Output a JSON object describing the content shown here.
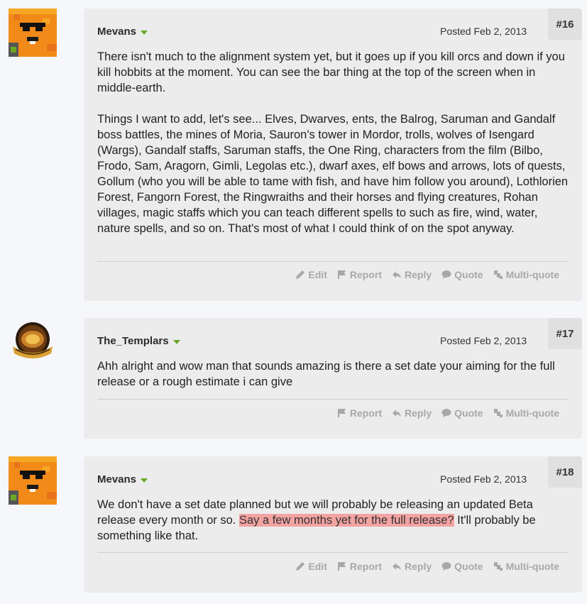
{
  "posts": [
    {
      "number": "#16",
      "author": "Mevans",
      "posted": "Posted Feb 2, 2013",
      "paragraphs": [
        "There isn't much to the alignment system yet, but it goes up if you kill orcs and down if you kill hobbits at the moment. You can see the bar thing at the top of the screen when in middle-earth.",
        "Things I want to add, let's see... Elves, Dwarves, ents, the Balrog, Saruman and Gandalf boss battles, the mines of Moria, Sauron's tower in Mordor, trolls, wolves of Isengard (Wargs), Gandalf staffs, Saruman staffs, the One Ring, characters from the film (Bilbo, Frodo, Sam, Aragorn, Gimli, Legolas etc.), dwarf axes, elf bows and arrows, lots of quests, Gollum (who you will be able to tame with fish, and have him follow you around), Lothlorien Forest, Fangorn Forest, the Ringwraiths and their horses and flying creatures, Rohan villages, magic staffs which you can teach different spells to such as fire, wind, water, nature spells, and so on. That's most of what I could think of on the spot anyway."
      ],
      "actions": {
        "edit": "Edit",
        "report": "Report",
        "reply": "Reply",
        "quote": "Quote",
        "multiquote": "Multi-quote"
      }
    },
    {
      "number": "#17",
      "author": "The_Templars",
      "posted": "Posted Feb 2, 2013",
      "paragraphs": [
        "Ahh alright and wow man that sounds amazing is there a set date your aiming for the full release or a rough estimate i can give"
      ],
      "actions": {
        "report": "Report",
        "reply": "Reply",
        "quote": "Quote",
        "multiquote": "Multi-quote"
      }
    },
    {
      "number": "#18",
      "author": "Mevans",
      "posted": "Posted Feb 2, 2013",
      "text_before": "We don't have a set date planned but we will probably be releasing an updated Beta release every month or so. ",
      "text_highlight": "Say a few months yet for the full release?",
      "text_after": " It'll probably be something like that.",
      "actions": {
        "edit": "Edit",
        "report": "Report",
        "reply": "Reply",
        "quote": "Quote",
        "multiquote": "Multi-quote"
      }
    }
  ],
  "colors": {
    "highlight": "#f4a3a3",
    "author_caret": "#6aa626",
    "card_bg": "#ececec"
  }
}
